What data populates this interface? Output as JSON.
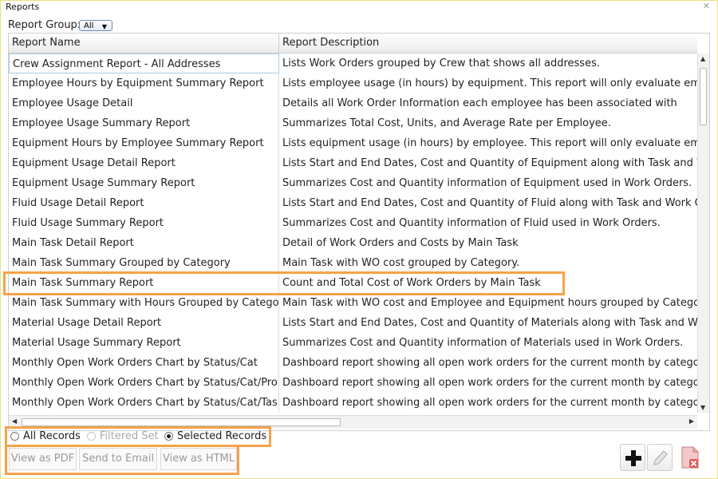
{
  "window": {
    "title": "Reports",
    "close_glyph": "✕"
  },
  "report_group": {
    "label": "Report Group:",
    "value": "All"
  },
  "table": {
    "columns": [
      "Report Name",
      "Report Description"
    ],
    "rows": [
      {
        "name": "Crew Assignment Report - All Addresses",
        "desc": "Lists Work Orders grouped by Crew that shows all addresses."
      },
      {
        "name": "Employee Hours by Equipment Summary Report",
        "desc": "Lists employee usage (in hours) by equipment.  This report will only evaluate employees"
      },
      {
        "name": "Employee Usage Detail",
        "desc": "Details all Work Order Information each employee has been associated with"
      },
      {
        "name": "Employee Usage Summary Report",
        "desc": "Summarizes Total Cost, Units, and Average Rate per Employee."
      },
      {
        "name": "Equipment Hours by Employee Summary Report",
        "desc": "Lists equipment usage (in hours) by employee.  This report will only evaluate employees"
      },
      {
        "name": "Equipment Usage Detail Report",
        "desc": "Lists Start and End Dates, Cost and Quantity of Equipment along with Task and Work"
      },
      {
        "name": "Equipment Usage Summary Report",
        "desc": "Summarizes Cost and Quantity information of Equipment used in Work Orders."
      },
      {
        "name": "Fluid Usage Detail Report",
        "desc": "Lists Start and End Dates, Cost and Quantity of Fluid along with Task and Work Order"
      },
      {
        "name": "Fluid Usage Summary Report",
        "desc": "Summarizes Cost and Quantity information of Fluid used in Work Orders."
      },
      {
        "name": "Main Task Detail Report",
        "desc": "Detail of Work Orders and Costs by Main Task"
      },
      {
        "name": "Main Task Summary Grouped by Category",
        "desc": "Main Task with WO cost grouped by Category."
      },
      {
        "name": "Main Task Summary Report",
        "desc": "Count and Total Cost of Work Orders by Main Task"
      },
      {
        "name": "Main Task Summary with Hours Grouped by Category",
        "desc": "Main Task with WO cost and Employee and Equipment hours grouped by Category."
      },
      {
        "name": "Material Usage Detail Report",
        "desc": "Lists Start and End Dates, Cost and Quantity of Materials along with Task and Work"
      },
      {
        "name": "Material Usage Summary Report",
        "desc": "Summarizes Cost and Quantity information of Materials used in Work Orders."
      },
      {
        "name": "Monthly Open Work Orders Chart by Status/Cat",
        "desc": "Dashboard report showing all open work orders for the current month by category"
      },
      {
        "name": "Monthly Open Work Orders Chart by Status/Cat/Prob",
        "desc": "Dashboard report showing all open work orders for the current month by category t"
      },
      {
        "name": "Monthly Open Work Orders Chart by Status/Cat/Task",
        "desc": "Dashboard report showing all open work orders for the current month by category t"
      }
    ]
  },
  "record_options": {
    "items": [
      {
        "label": "All Records",
        "selected": false,
        "enabled": true
      },
      {
        "label": "Filtered Set",
        "selected": false,
        "enabled": false
      },
      {
        "label": "Selected Records",
        "selected": true,
        "enabled": true
      }
    ]
  },
  "actions": {
    "view_pdf": "View as PDF",
    "send_email": "Send to Email",
    "view_html": "View as HTML"
  },
  "toolbar_icons": [
    "add-icon",
    "edit-icon",
    "delete-report-icon"
  ],
  "colors": {
    "highlight": "#f5a24a",
    "accent_border": "#a9cbe4"
  }
}
